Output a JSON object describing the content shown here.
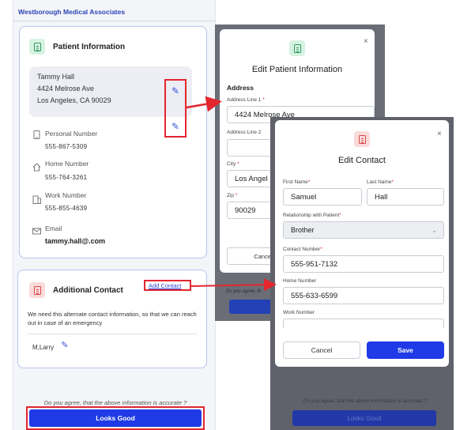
{
  "header": {
    "title": "Westborough Medical Associates"
  },
  "patient_card": {
    "title": "Patient Information",
    "address": {
      "name": "Tammy Hall",
      "line1": "4424 Melrose Ave",
      "line2": "Los Angeles, CA 90029"
    },
    "personal_number": {
      "label": "Personal Number",
      "value": "555-867-5309"
    },
    "home_number": {
      "label": "Home Number",
      "value": "555-764-3261"
    },
    "work_number": {
      "label": "Work Number",
      "value": "555-855-4639"
    },
    "email": {
      "label": "Email",
      "value": "tammy.hall@.com"
    }
  },
  "contact_card": {
    "title": "Additional Contact",
    "add_link": "Add Contact",
    "description": "We need this alternate contact information, so that we can reach out in case of an emergency",
    "contact_name": "M,Larry"
  },
  "footer": {
    "confirm_text": "Do you agree, that the above information is accurate ?",
    "looks_good_label": "Looks Good"
  },
  "edit_patient_modal": {
    "title": "Edit Patient Information",
    "close": "×",
    "section": "Address",
    "address_line1_label": "Address Line 1",
    "address_line1_value": "4424 Melrose Ave",
    "address_line2_label": "Address Line 2",
    "address_line2_value": "",
    "city_label": "City",
    "city_value": "Los Angel",
    "zip_label": "Zip",
    "zip_value": "90029",
    "cancel_label": "Cancel",
    "required_mark": "*",
    "bg_confirm_text": "Do you agree, th"
  },
  "edit_contact_modal": {
    "title": "Edit Contact",
    "close": "×",
    "first_name_label": "First Name",
    "first_name_value": "Samuel",
    "last_name_label": "Last Name",
    "last_name_value": "Hall",
    "relationship_label": "Relationship with Patient",
    "relationship_value": "Brother",
    "contact_number_label": "Contact Number",
    "contact_number_value": "555-951-7132",
    "home_number_label": "Home Number",
    "home_number_value": "555-633-6599",
    "work_number_label": "Work Number",
    "work_number_value": "",
    "cancel_label": "Cancel",
    "save_label": "Save",
    "required_mark": "*",
    "bg_confirm_text": "Do you agree, that the above information is accurate ?",
    "bg_looks_good_label": "Looks Good"
  },
  "colors": {
    "accent": "#1f3ae6",
    "highlight": "#e3262f",
    "card_border": "#b9c3ee"
  }
}
